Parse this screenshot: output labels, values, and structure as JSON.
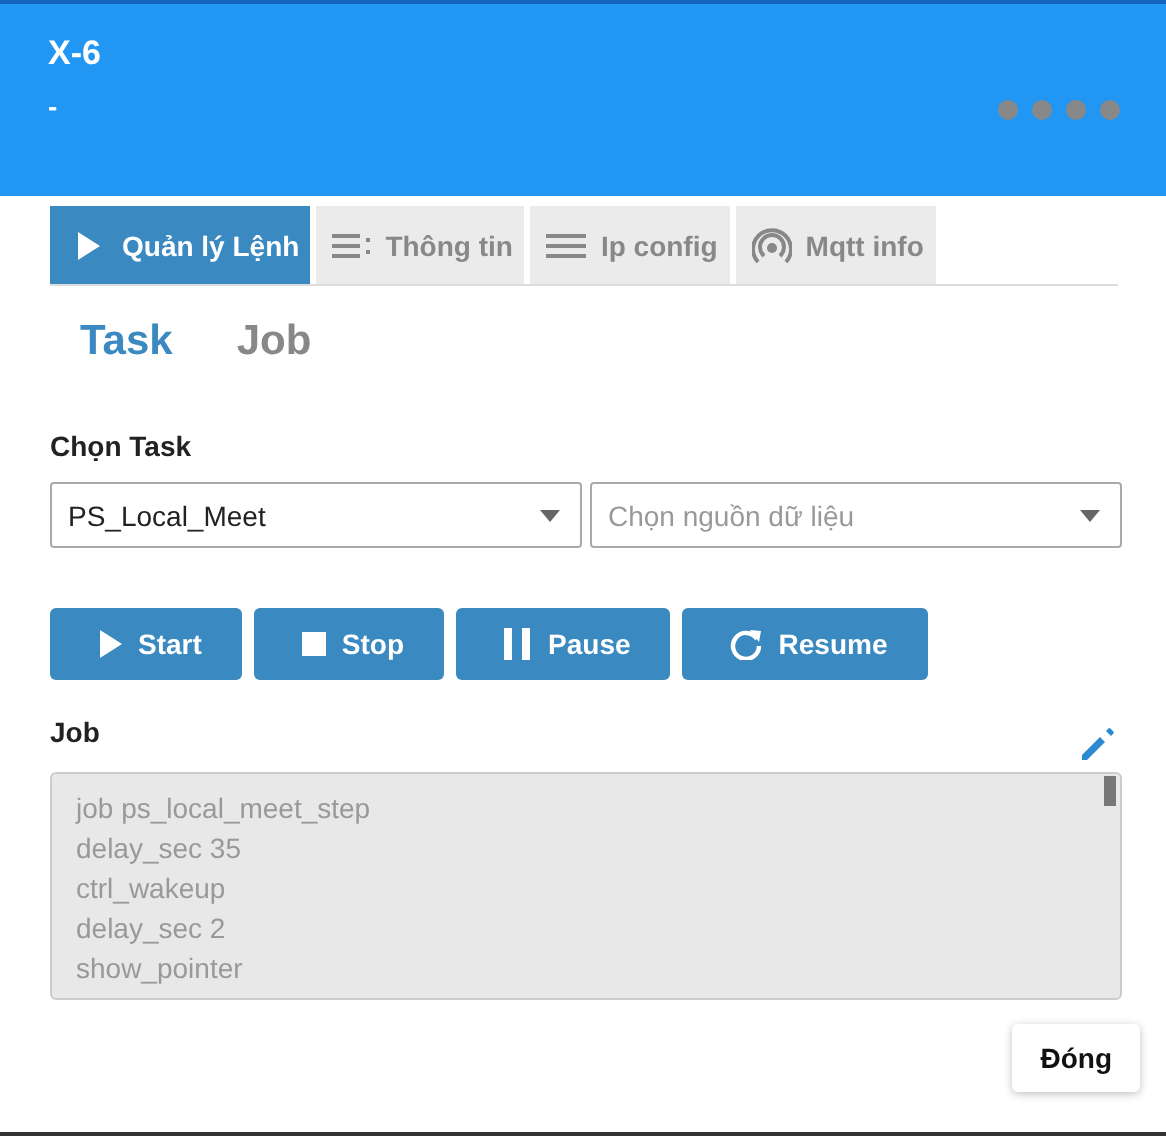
{
  "header": {
    "title": "X-6",
    "subtitle": "-"
  },
  "tabs": [
    {
      "label": "Quản lý Lệnh",
      "kind": "play",
      "selected": true
    },
    {
      "label": "Thông tin",
      "kind": "list",
      "selected": false
    },
    {
      "label": "Ip config",
      "kind": "menu",
      "selected": false
    },
    {
      "label": "Mqtt info",
      "kind": "signal",
      "selected": false
    }
  ],
  "subtabs": [
    {
      "label": "Task",
      "selected": true
    },
    {
      "label": "Job",
      "selected": false
    }
  ],
  "task_label": "Chọn Task",
  "task_select": {
    "value": "PS_Local_Meet"
  },
  "source_select": {
    "placeholder": "Chọn nguồn dữ liệu"
  },
  "buttons": [
    {
      "label": "Start",
      "kind": "play"
    },
    {
      "label": "Stop",
      "kind": "stop"
    },
    {
      "label": "Pause",
      "kind": "pause"
    },
    {
      "label": "Resume",
      "kind": "refresh"
    }
  ],
  "job_label": "Job",
  "job_lines": [
    "job ps_local_meet_step",
    "delay_sec 35",
    "ctrl_wakeup",
    "delay_sec 2",
    "show_pointer"
  ],
  "close_button": "Đóng"
}
